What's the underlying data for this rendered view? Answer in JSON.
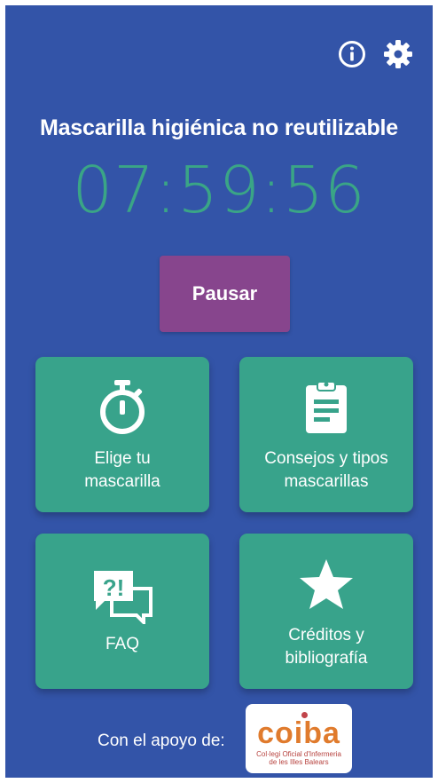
{
  "header": {
    "info_icon": "info-circle-icon",
    "settings_icon": "gear-icon"
  },
  "main": {
    "title": "Mascarilla higiénica no reutilizable",
    "timer": "07:59:56",
    "pause_label": "Pausar"
  },
  "cards": [
    {
      "label": "Elige tu\nmascarilla",
      "icon": "stopwatch-icon"
    },
    {
      "label": "Consejos y tipos\nmascarillas",
      "icon": "clipboard-icon"
    },
    {
      "label": "FAQ",
      "icon": "faq-chat-icon"
    },
    {
      "label": "Créditos y\nbibliografía",
      "icon": "star-icon"
    }
  ],
  "footer": {
    "support_text": "Con el apoyo de:",
    "logo_text": "coiba",
    "logo_subtitle": "Col·legi Oficial d'Infermeria\nde les Illes Balears"
  },
  "colors": {
    "background": "#3354a8",
    "timer": "#3aa586",
    "pause_button": "#87458d",
    "card": "#38a38b",
    "logo_accent": "#e07b2d"
  }
}
